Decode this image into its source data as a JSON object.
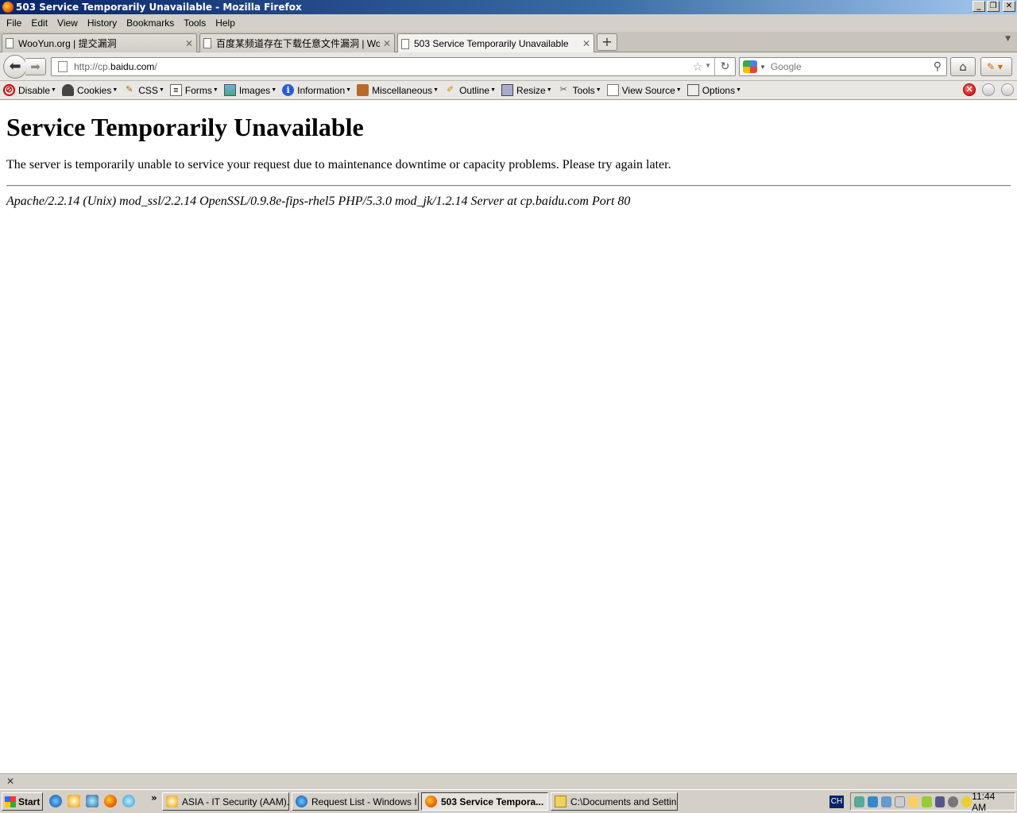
{
  "window": {
    "title": "503 Service Temporarily Unavailable - Mozilla Firefox",
    "controls": [
      "_",
      "❐",
      "✕"
    ]
  },
  "menu": [
    "File",
    "Edit",
    "View",
    "History",
    "Bookmarks",
    "Tools",
    "Help"
  ],
  "tabs": [
    {
      "label": "WooYun.org | 提交漏洞",
      "active": false
    },
    {
      "label": "百度某频道存在下载任意文件漏洞 | Woo...",
      "active": false
    },
    {
      "label": "503 Service Temporarily Unavailable",
      "active": true
    }
  ],
  "nav": {
    "url_prefix": "http://cp.",
    "url_domain": "baidu.com",
    "url_suffix": "/",
    "search_placeholder": "Google"
  },
  "devtoolbar": [
    {
      "label": "Disable",
      "icon": "disable-icon"
    },
    {
      "label": "Cookies",
      "icon": "cookie-icon"
    },
    {
      "label": "CSS",
      "icon": "css-icon"
    },
    {
      "label": "Forms",
      "icon": "forms-icon"
    },
    {
      "label": "Images",
      "icon": "images-icon"
    },
    {
      "label": "Information",
      "icon": "information-icon"
    },
    {
      "label": "Miscellaneous",
      "icon": "miscellaneous-icon"
    },
    {
      "label": "Outline",
      "icon": "outline-icon"
    },
    {
      "label": "Resize",
      "icon": "resize-icon"
    },
    {
      "label": "Tools",
      "icon": "tools-icon"
    },
    {
      "label": "View Source",
      "icon": "view-source-icon"
    },
    {
      "label": "Options",
      "icon": "options-icon"
    }
  ],
  "page": {
    "heading": "Service Temporarily Unavailable",
    "message": "The server is temporarily unable to service your request due to maintenance downtime or capacity problems. Please try again later.",
    "signature": "Apache/2.2.14 (Unix) mod_ssl/2.2.14 OpenSSL/0.9.8e-fips-rhel5 PHP/5.3.0 mod_jk/1.2.14 Server at cp.baidu.com Port 80"
  },
  "taskbar": {
    "start_label": "Start",
    "tasks": [
      {
        "label": "ASIA - IT Security (AAM)...",
        "active": false
      },
      {
        "label": "Request List - Windows I...",
        "active": false
      },
      {
        "label": "503 Service Tempora...",
        "active": true
      },
      {
        "label": "C:\\Documents and Settin...",
        "active": false
      }
    ],
    "language": "CH",
    "clock": "11:44 AM"
  }
}
